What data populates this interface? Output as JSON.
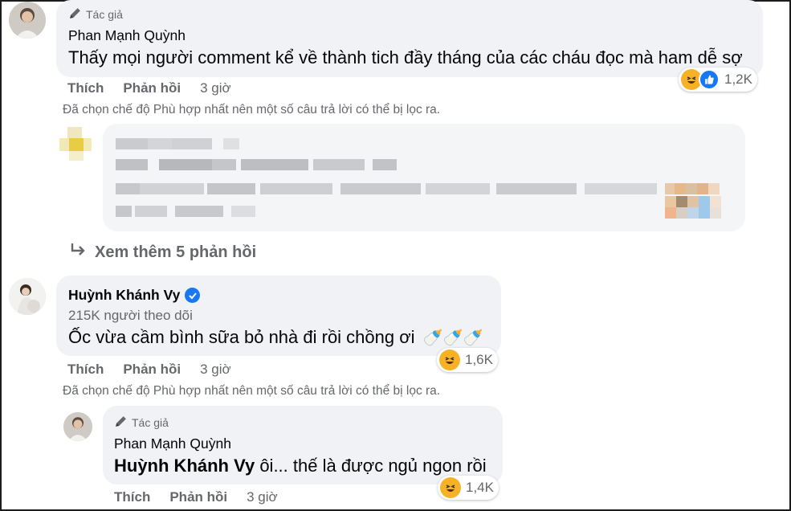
{
  "comment1": {
    "author_tag": "Tác giả",
    "name": "Phan Mạnh Quỳnh",
    "text": "Thấy mọi người comment kể về thành tich đầy tháng của các cháu đọc mà ham dễ sợ",
    "reaction_count": "1,2K",
    "reaction_icons": [
      "haha-icon",
      "like-icon"
    ],
    "actions": {
      "like": "Thích",
      "reply": "Phản hồi",
      "time": "3 giờ"
    },
    "filter_note": "Đã chọn chế độ Phù hợp nhất nên một số câu trả lời có thể bị lọc ra."
  },
  "see_more": {
    "label": "Xem thêm 5 phản hồi",
    "icon": "reply-arrow-icon"
  },
  "comment2": {
    "name": "Huỳnh Khánh Vy",
    "verified": true,
    "followers": "215K người theo dõi",
    "text": "Ốc vừa cầm bình sữa bỏ nhà đi rồi chồng ơi",
    "emoji_suffix": "🍼🍼🍼",
    "reaction_count": "1,6K",
    "reaction_icons": [
      "haha-icon"
    ],
    "actions": {
      "like": "Thích",
      "reply": "Phản hồi",
      "time": "3 giờ"
    },
    "filter_note": "Đã chọn chế độ Phù hợp nhất nên một số câu trả lời có thể bị lọc ra."
  },
  "reply1": {
    "author_tag": "Tác giả",
    "name": "Phan Mạnh Quỳnh",
    "mention": "Huỳnh Khánh Vy",
    "text": " ôi... thế là được ngủ ngon rồi",
    "reaction_count": "1,4K",
    "reaction_icons": [
      "haha-icon"
    ],
    "actions": {
      "like": "Thích",
      "reply": "Phản hồi",
      "time": "3 giờ"
    }
  },
  "colors": {
    "bubble": "#f0f2f5",
    "secondary_text": "#65676b",
    "primary_text": "#050505",
    "accent_blue": "#1877f2",
    "haha_yellow": "#f7b125"
  }
}
